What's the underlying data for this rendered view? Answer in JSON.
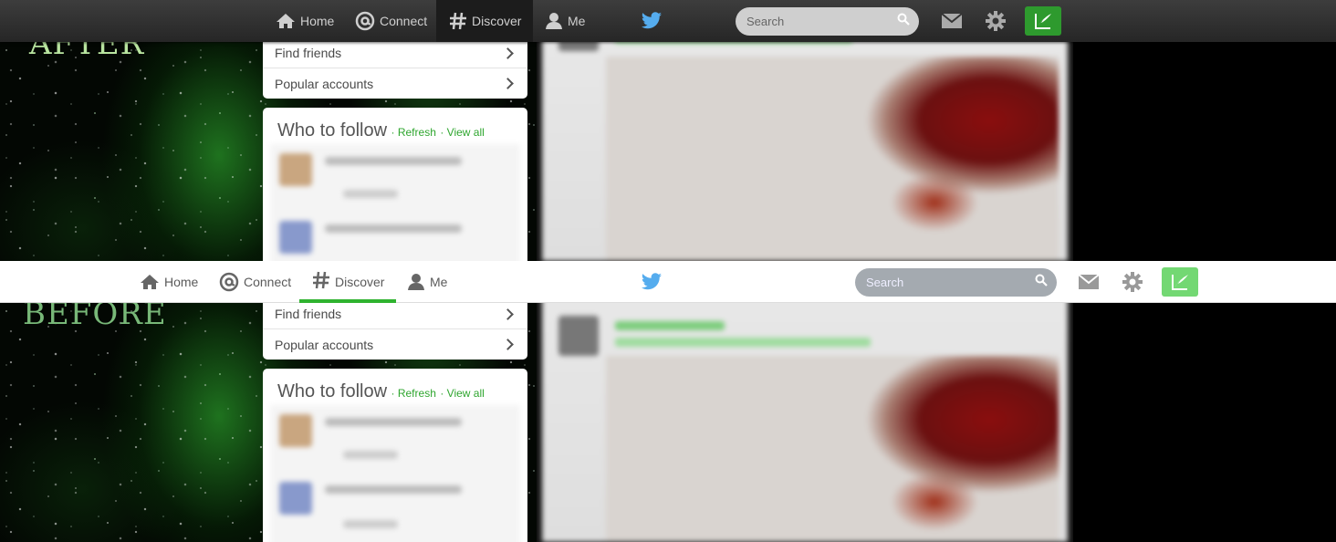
{
  "labels": {
    "after": "AFTER",
    "before": "BEFORE"
  },
  "nav": {
    "home": "Home",
    "connect": "Connect",
    "discover": "Discover",
    "me": "Me",
    "search_placeholder": "Search"
  },
  "sidebar": {
    "find_friends": "Find friends",
    "popular_accounts": "Popular accounts"
  },
  "who_to_follow": {
    "title": "Who to follow",
    "refresh": "· Refresh",
    "view_all": "· View all"
  },
  "colors": {
    "accent_green": "#2fb32f",
    "twitter_blue": "#55acee",
    "compose_after": "#2e9a2e",
    "compose_before": "#73d873"
  },
  "icons": [
    "home-icon",
    "connect-icon",
    "discover-icon",
    "me-icon",
    "twitter-bird-icon",
    "search-icon",
    "messages-icon",
    "gear-icon",
    "compose-icon",
    "chevron-right-icon"
  ]
}
